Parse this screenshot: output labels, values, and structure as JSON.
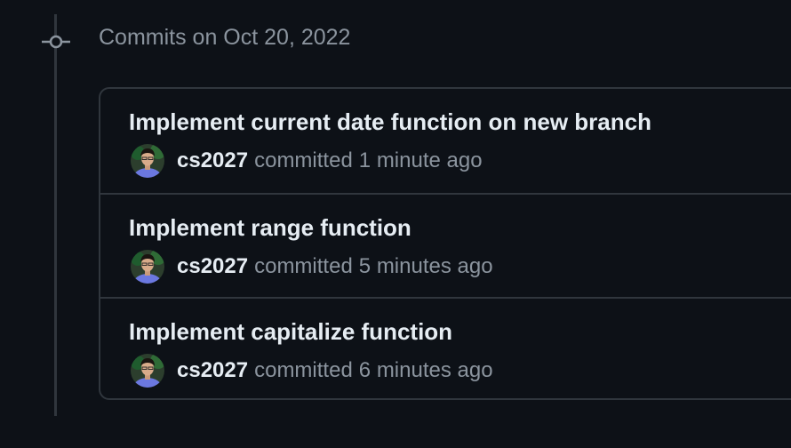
{
  "timeline": {
    "date_heading": "Commits on Oct 20, 2022"
  },
  "commits": [
    {
      "title": "Implement current date function on new branch",
      "author": "cs2027",
      "verb": "committed",
      "time": "1 minute ago"
    },
    {
      "title": "Implement range function",
      "author": "cs2027",
      "verb": "committed",
      "time": "5 minutes ago"
    },
    {
      "title": "Implement capitalize function",
      "author": "cs2027",
      "verb": "committed",
      "time": "6 minutes ago"
    }
  ],
  "colors": {
    "background": "#0d1117",
    "border": "#30363d",
    "text_primary": "#e6edf3",
    "text_muted": "#8b949e"
  },
  "icons": {
    "timeline_node": "git-commit-icon",
    "avatar": "user-avatar-icon"
  }
}
